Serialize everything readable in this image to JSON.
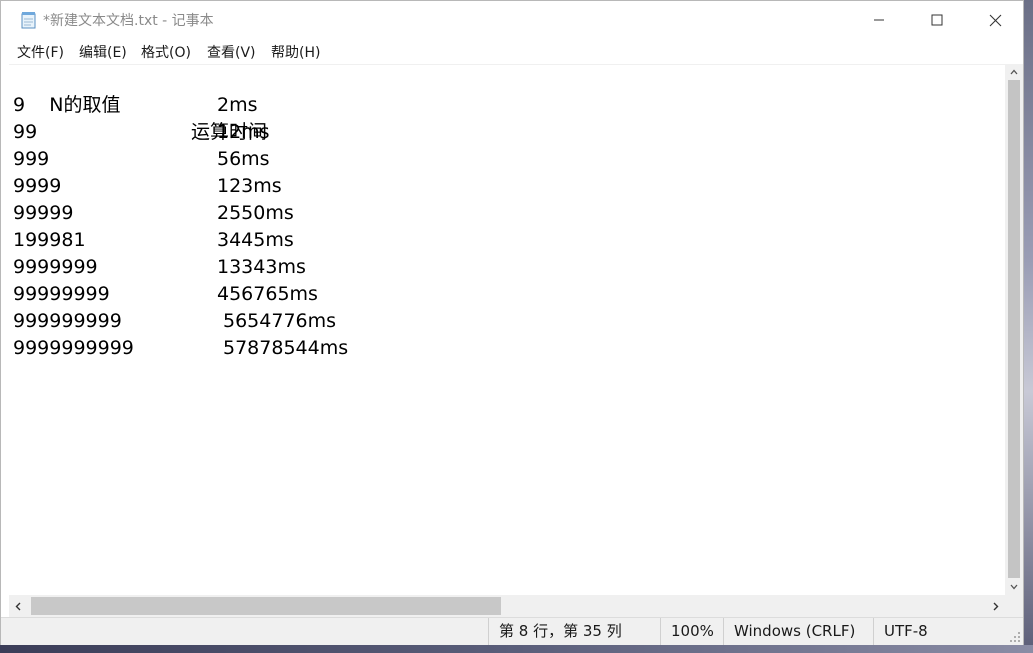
{
  "window": {
    "title": "*新建文本文档.txt - 记事本",
    "controls": {
      "minimize": "—",
      "maximize": "☐",
      "close": "✕"
    }
  },
  "menu": [
    "文件(F)",
    "编辑(E)",
    "格式(O)",
    "查看(V)",
    "帮助(H)"
  ],
  "document": {
    "header": {
      "n": "N的取值",
      "time": "运算时间"
    },
    "rows": [
      {
        "n": "9",
        "time": "2ms"
      },
      {
        "n": "99",
        "time": "12ms"
      },
      {
        "n": "999",
        "time": "56ms"
      },
      {
        "n": "9999",
        "time": "123ms"
      },
      {
        "n": "99999",
        "time": "2550ms"
      },
      {
        "n": "199981",
        "time": "3445ms"
      },
      {
        "n": "9999999",
        "time": "13343ms"
      },
      {
        "n": "99999999",
        "time": "456765ms"
      },
      {
        "n": "999999999",
        "time": "5654776ms"
      },
      {
        "n": "9999999999",
        "time": "57878544ms"
      }
    ]
  },
  "status": {
    "position": "第 8 行，第 35 列",
    "zoom": "100%",
    "line_ending": "Windows (CRLF)",
    "encoding": "UTF-8"
  },
  "icons": {
    "app": "notepad-icon",
    "scroll_up": "chevron-up-icon",
    "scroll_down": "chevron-down-icon",
    "scroll_left": "chevron-left-icon",
    "scroll_right": "chevron-right-icon"
  }
}
